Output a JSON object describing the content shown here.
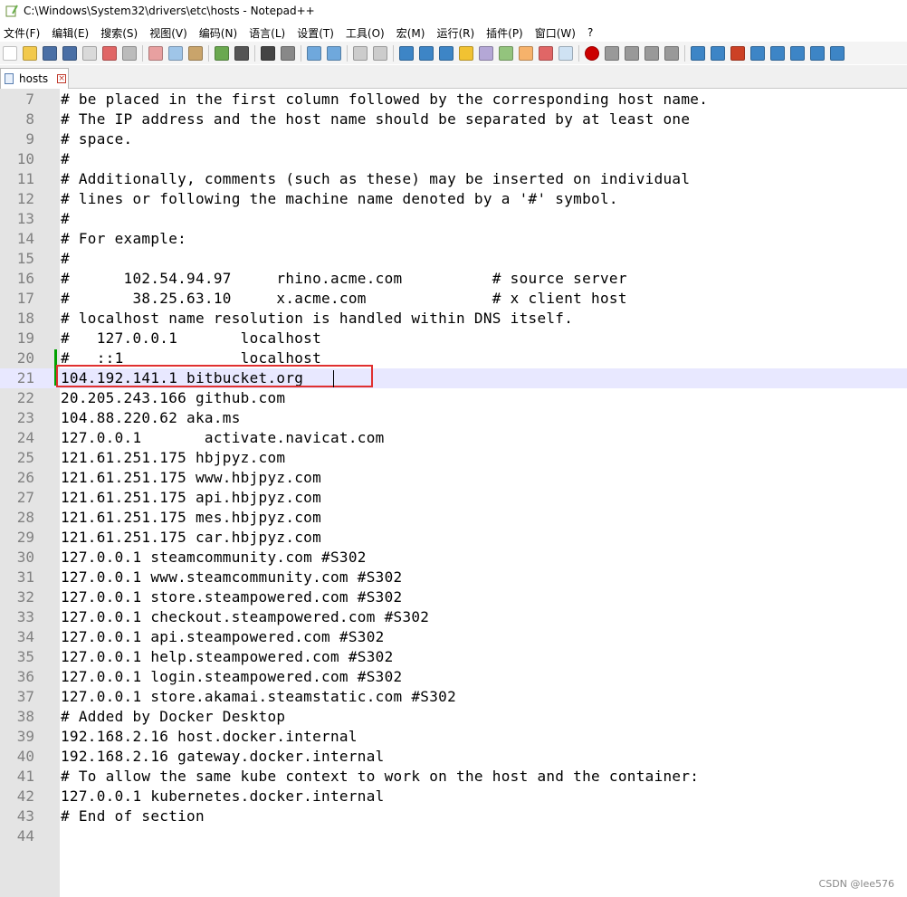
{
  "window": {
    "title": "C:\\Windows\\System32\\drivers\\etc\\hosts - Notepad++"
  },
  "menu": [
    "文件(F)",
    "编辑(E)",
    "搜索(S)",
    "视图(V)",
    "编码(N)",
    "语言(L)",
    "设置(T)",
    "工具(O)",
    "宏(M)",
    "运行(R)",
    "插件(P)",
    "窗口(W)",
    "?"
  ],
  "tab": {
    "label": "hosts"
  },
  "editor": {
    "current_line": 21,
    "lines": [
      {
        "n": "7",
        "text": "# be placed in the first column followed by the corresponding host name."
      },
      {
        "n": "8",
        "text": "# The IP address and the host name should be separated by at least one"
      },
      {
        "n": "9",
        "text": "# space."
      },
      {
        "n": "10",
        "text": "#"
      },
      {
        "n": "11",
        "text": "# Additionally, comments (such as these) may be inserted on individual"
      },
      {
        "n": "12",
        "text": "# lines or following the machine name denoted by a '#' symbol."
      },
      {
        "n": "13",
        "text": "#"
      },
      {
        "n": "14",
        "text": "# For example:"
      },
      {
        "n": "15",
        "text": "#"
      },
      {
        "n": "16",
        "text": "#      102.54.94.97     rhino.acme.com          # source server"
      },
      {
        "n": "17",
        "text": "#       38.25.63.10     x.acme.com              # x client host"
      },
      {
        "n": "18",
        "text": "# localhost name resolution is handled within DNS itself."
      },
      {
        "n": "19",
        "text": "#   127.0.0.1       localhost"
      },
      {
        "n": "20",
        "text": "#   ::1             localhost"
      },
      {
        "n": "21",
        "text": "104.192.141.1 bitbucket.org"
      },
      {
        "n": "22",
        "text": "20.205.243.166 github.com"
      },
      {
        "n": "23",
        "text": "104.88.220.62 aka.ms"
      },
      {
        "n": "24",
        "text": "127.0.0.1       activate.navicat.com"
      },
      {
        "n": "25",
        "text": "121.61.251.175 hbjpyz.com"
      },
      {
        "n": "26",
        "text": "121.61.251.175 www.hbjpyz.com"
      },
      {
        "n": "27",
        "text": "121.61.251.175 api.hbjpyz.com"
      },
      {
        "n": "28",
        "text": "121.61.251.175 mes.hbjpyz.com"
      },
      {
        "n": "29",
        "text": "121.61.251.175 car.hbjpyz.com"
      },
      {
        "n": "30",
        "text": "127.0.0.1 steamcommunity.com #S302"
      },
      {
        "n": "31",
        "text": "127.0.0.1 www.steamcommunity.com #S302"
      },
      {
        "n": "32",
        "text": "127.0.0.1 store.steampowered.com #S302"
      },
      {
        "n": "33",
        "text": "127.0.0.1 checkout.steampowered.com #S302"
      },
      {
        "n": "34",
        "text": "127.0.0.1 api.steampowered.com #S302"
      },
      {
        "n": "35",
        "text": "127.0.0.1 help.steampowered.com #S302"
      },
      {
        "n": "36",
        "text": "127.0.0.1 login.steampowered.com #S302"
      },
      {
        "n": "37",
        "text": "127.0.0.1 store.akamai.steamstatic.com #S302"
      },
      {
        "n": "38",
        "text": "# Added by Docker Desktop"
      },
      {
        "n": "39",
        "text": "192.168.2.16 host.docker.internal"
      },
      {
        "n": "40",
        "text": "192.168.2.16 gateway.docker.internal"
      },
      {
        "n": "41",
        "text": "# To allow the same kube context to work on the host and the container:"
      },
      {
        "n": "42",
        "text": "127.0.0.1 kubernetes.docker.internal"
      },
      {
        "n": "43",
        "text": "# End of section"
      },
      {
        "n": "44",
        "text": ""
      }
    ]
  },
  "watermark": "CSDN @lee576",
  "colors": {
    "gutter": "#e4e4e4",
    "current_line": "#e8e8ff",
    "highlight_border": "#e03030",
    "change_mark": "#00a000"
  }
}
